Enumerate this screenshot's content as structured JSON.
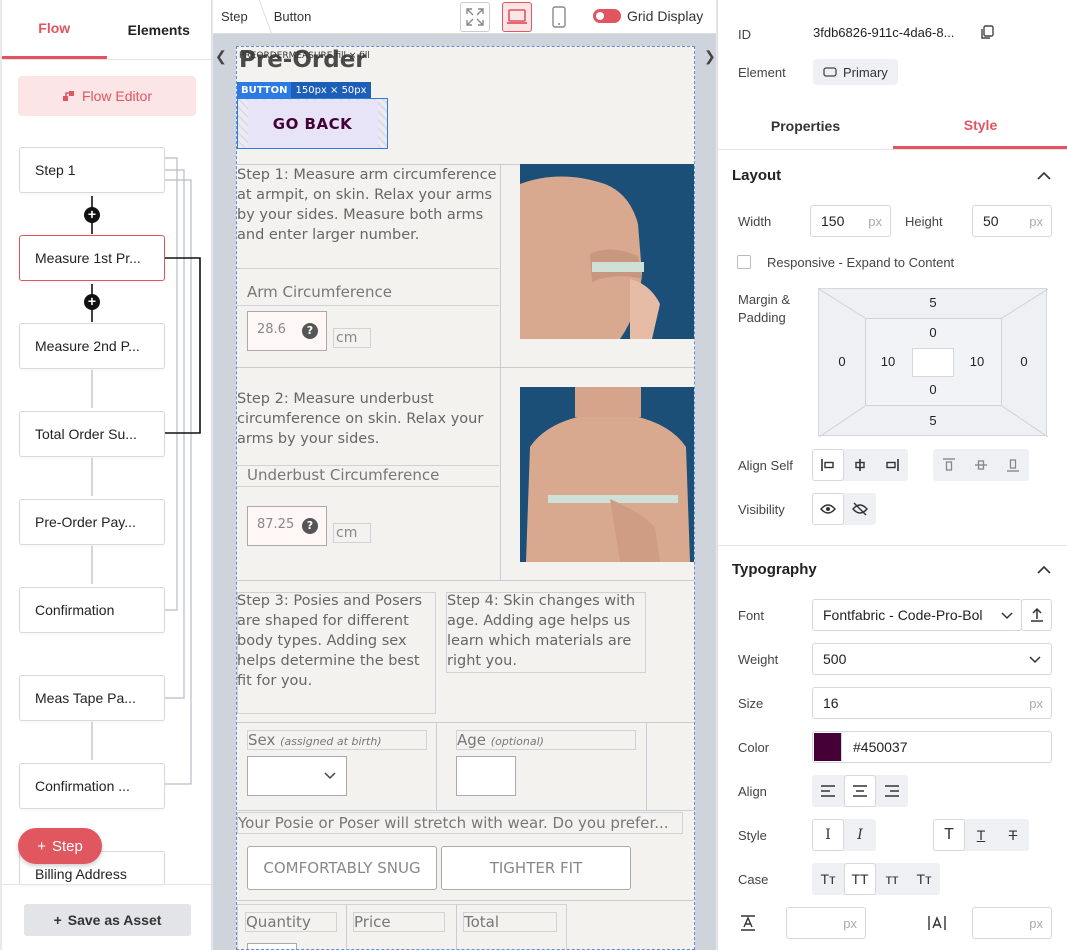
{
  "left": {
    "tabs": [
      "Flow",
      "Elements"
    ],
    "flow_editor_label": "Flow Editor",
    "nodes": [
      "Step 1",
      "Measure 1st Pr...",
      "Measure 2nd P...",
      "Total Order Su...",
      "Pre-Order Pay...",
      "Confirmation",
      "Meas Tape Pa...",
      "Confirmation ...",
      "Billing Address"
    ],
    "step_button": "Step",
    "save_asset": "Save as Asset"
  },
  "center": {
    "breadcrumb": [
      "Step",
      "Button"
    ],
    "grid_display": "Grid Display",
    "canvas": {
      "title": "Pre-Order",
      "fill_tag": "PREORDERMEASURE",
      "fill_dim": "fill × fill",
      "button_tag": "BUTTON",
      "button_dim": "150px × 50px",
      "go_back": "GO BACK",
      "step1": "Step 1: Measure arm circumference at armpit, on skin. Relax your arms by your sides. Measure both arms and enter larger number.",
      "arm_label": "Arm Circumference",
      "arm_value": "28.6",
      "unit_cm": "cm",
      "step2": "Step 2: Measure underbust circumference on skin. Relax your arms by your sides.",
      "underbust_label": "Underbust Circumference",
      "underbust_value": "87.25",
      "step3": "Step 3: Posies and Posers are shaped for different body types. Adding sex helps determine the best fit for you.",
      "step4": "Step 4: Skin changes with age. Adding age helps us learn which materials are right you.",
      "sex_label": "Sex",
      "sex_hint": "(assigned at birth)",
      "age_label": "Age",
      "age_hint": "(optional)",
      "stretch_text": "Your Posie or Poser will stretch with wear. Do you prefer...",
      "opt_snug": "COMFORTABLY SNUG",
      "opt_tight": "TIGHTER FIT",
      "quantity": "Quantity",
      "price": "Price",
      "total": "Total"
    }
  },
  "right": {
    "id_label": "ID",
    "id_value": "3fdb6826-911c-4da6-8...",
    "element_label": "Element",
    "element_value": "Primary",
    "tabs": [
      "Properties",
      "Style"
    ],
    "layout": {
      "title": "Layout",
      "width_label": "Width",
      "width_value": "150",
      "height_label": "Height",
      "height_value": "50",
      "unit": "px",
      "responsive": "Responsive - Expand to Content",
      "margin_label_1": "Margin &",
      "margin_label_2": "Padding",
      "margin": {
        "top": "5",
        "right": "0",
        "bottom": "5",
        "left": "0"
      },
      "padding": {
        "top": "0",
        "right": "10",
        "bottom": "0",
        "left": "10"
      },
      "align_self": "Align Self",
      "visibility": "Visibility"
    },
    "typography": {
      "title": "Typography",
      "font_label": "Font",
      "font_value": "Fontfabric - Code-Pro-Bol",
      "weight_label": "Weight",
      "weight_value": "500",
      "size_label": "Size",
      "size_value": "16",
      "color_label": "Color",
      "color_value": "#450037",
      "align_label": "Align",
      "style_label": "Style",
      "case_label": "Case",
      "case_options": [
        "Tт",
        "TT",
        "тт",
        "Tт"
      ]
    }
  },
  "colors": {
    "accent": "#e05560",
    "selection": "#2b7be4",
    "text_color": "#450037"
  }
}
